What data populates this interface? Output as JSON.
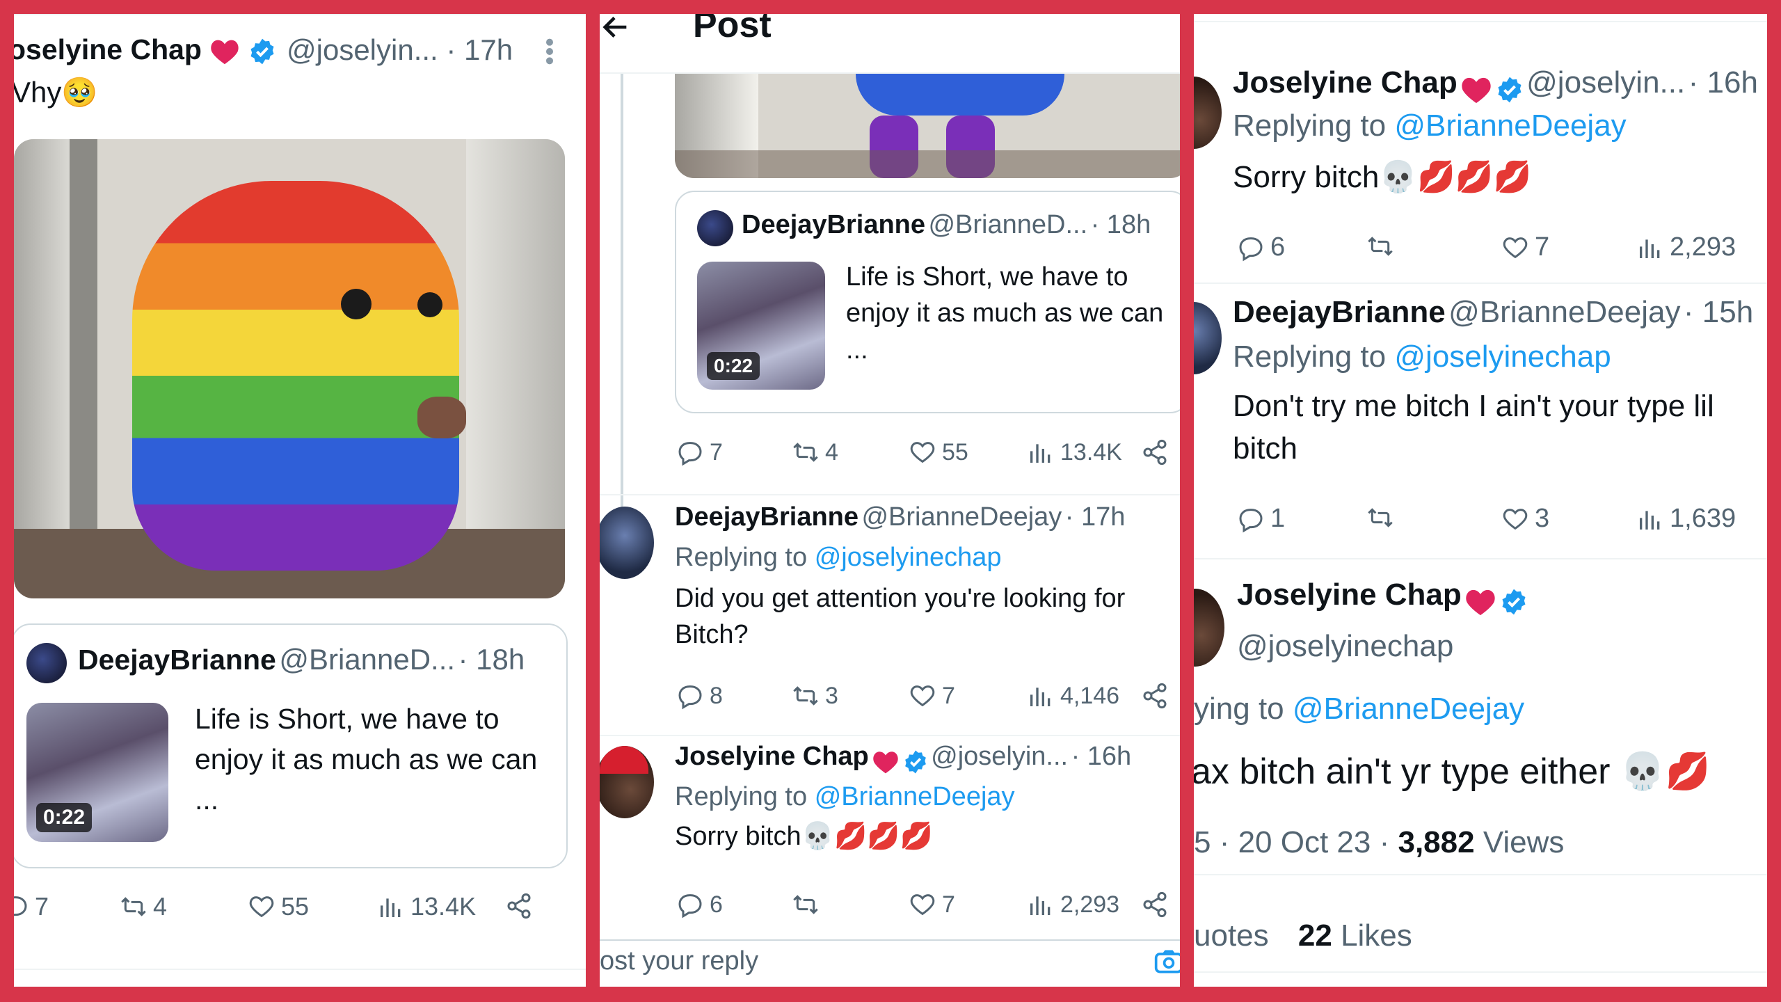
{
  "colors": {
    "frame": "#d7354a",
    "link": "#1d9bf0",
    "muted": "#536471",
    "verified": "#1d9bf0",
    "heart": "#e0245e"
  },
  "panel1": {
    "author_name": "oselyine Chap",
    "author_handle": "@joselyin...",
    "time": "· 17h",
    "more_icon": "more-vertical-icon",
    "tweet_text": "Vhy",
    "tweet_emoji": "🥹",
    "quote": {
      "name": "DeejayBrianne",
      "handle": "@BrianneD...",
      "time": "· 18h",
      "text": "Life is Short, we have to enjoy it as much as we can ...",
      "duration": "0:22"
    },
    "actions": {
      "replies": "7",
      "reposts": "4",
      "likes": "55",
      "views": "13.4K"
    }
  },
  "panel2": {
    "header_title": "Post",
    "quote": {
      "name": "DeejayBrianne",
      "handle": "@BrianneD...",
      "time": "· 18h",
      "text": "Life is Short, we have to enjoy it as much as we can ...",
      "duration": "0:22"
    },
    "main_actions": {
      "replies": "7",
      "reposts": "4",
      "likes": "55",
      "views": "13.4K"
    },
    "reply1": {
      "name": "DeejayBrianne",
      "handle": "@BrianneDeejay",
      "time": "· 17h",
      "replying_label": "Replying to",
      "replying_to": "@joselyinechap",
      "text": "Did you get attention you're looking for Bitch?",
      "actions": {
        "replies": "8",
        "reposts": "3",
        "likes": "7",
        "views": "4,146"
      }
    },
    "reply2": {
      "name": "Joselyine Chap",
      "handle": "@joselyin...",
      "time": "· 16h",
      "replying_label": "Replying to",
      "replying_to": "@BrianneDeejay",
      "text": "Sorry bitch",
      "emoji": "💀💋💋💋",
      "actions": {
        "replies": "6",
        "reposts": "",
        "likes": "7",
        "views": "2,293"
      }
    },
    "reply_placeholder": "ost your reply"
  },
  "panel3": {
    "reply1": {
      "name": "Joselyine Chap",
      "handle": "@joselyin...",
      "time": "· 16h",
      "replying_label": "Replying to",
      "replying_to": "@BrianneDeejay",
      "text": "Sorry bitch",
      "emoji": "💀💋💋💋",
      "actions": {
        "replies": "6",
        "reposts": "",
        "likes": "7",
        "views": "2,293"
      }
    },
    "reply2": {
      "name": "DeejayBrianne",
      "handle": "@BrianneDeejay",
      "time": "· 15h",
      "replying_label": "Replying to",
      "replying_to": "@joselyinechap",
      "text": "Don't try me bitch I ain't your type lil bitch",
      "actions": {
        "replies": "1",
        "reposts": "",
        "likes": "3",
        "views": "1,639"
      }
    },
    "main": {
      "name": "Joselyine Chap",
      "handle": "@joselyinechap",
      "replying_label": "ying to",
      "replying_to": "@BrianneDeejay",
      "text": "ax bitch ain't yr type either",
      "emoji": "💀💋",
      "meta_prefix": "5 · 20 Oct 23 ·",
      "views_count": "3,882",
      "views_label": "Views",
      "quotes_label": "uotes",
      "likes_count": "22",
      "likes_label": "Likes"
    }
  }
}
